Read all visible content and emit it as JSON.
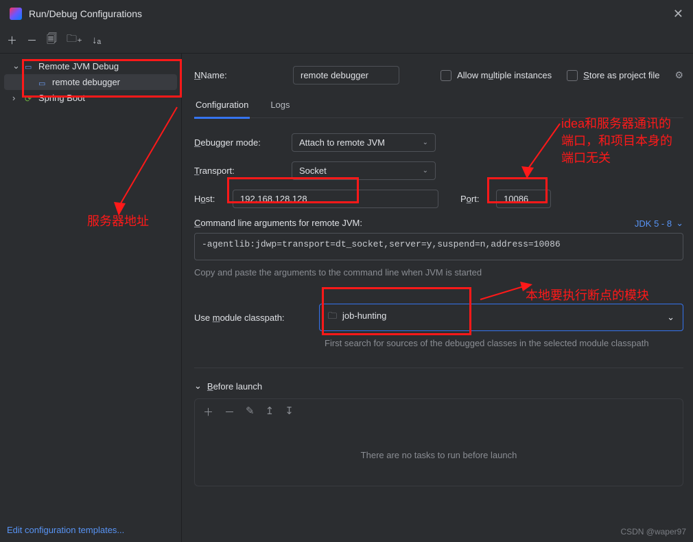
{
  "window": {
    "title": "Run/Debug Configurations"
  },
  "sidebar": {
    "items": [
      {
        "label": "Remote JVM Debug",
        "expanded": true
      },
      {
        "label": "remote debugger",
        "child": true,
        "selected": true
      },
      {
        "label": "Spring Boot",
        "expanded": false
      }
    ],
    "editTemplates": "Edit configuration templates..."
  },
  "header": {
    "nameLabel": "Name:",
    "nameValue": "remote debugger",
    "allowMultiple": "Allow multiple instances",
    "storeAsProject": "Store as project file"
  },
  "tabs": {
    "configuration": "Configuration",
    "logs": "Logs"
  },
  "form": {
    "debuggerModeLabel": "Debugger mode:",
    "debuggerMode": "Attach to remote JVM",
    "transportLabel": "Transport:",
    "transport": "Socket",
    "hostLabel": "Host:",
    "host": "192.168.128.128",
    "portLabel": "Port:",
    "port": "10086",
    "cmdArgsLabel": "Command line arguments for remote JVM:",
    "jdkLabel": "JDK 5 - 8",
    "cmdArgs": "-agentlib:jdwp=transport=dt_socket,server=y,suspend=n,address=10086",
    "copyHint": "Copy and paste the arguments to the command line when JVM is started",
    "moduleLabel": "Use module classpath:",
    "module": "job-hunting",
    "moduleHint": "First search for sources of the debugged classes in the selected module classpath"
  },
  "beforeLaunch": {
    "title": "Before launch",
    "empty": "There are no tasks to run before launch"
  },
  "annotations": {
    "serverAddr": "服务器地址",
    "portNote": "idea和服务器通讯的端口，和项目本身的端口无关",
    "moduleNote": "本地要执行断点的模块"
  },
  "watermark": "CSDN @waper97"
}
